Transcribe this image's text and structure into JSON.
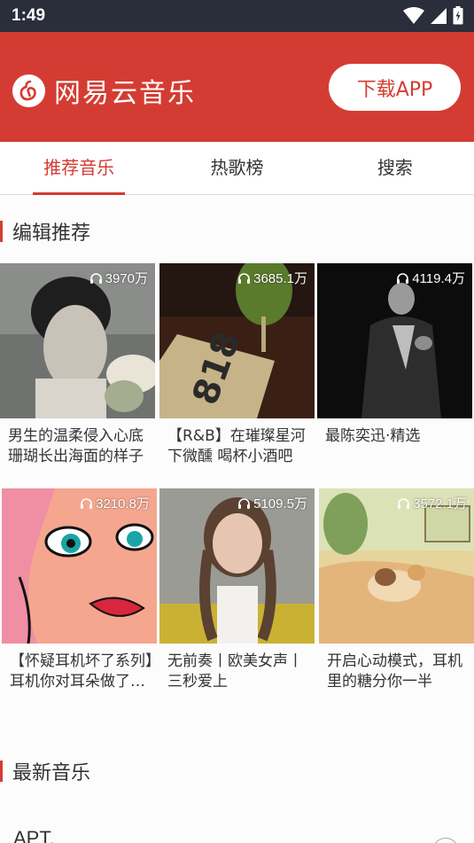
{
  "status_bar": {
    "time": "1:49",
    "icons": [
      "wifi-icon",
      "cell-signal-icon",
      "battery-icon"
    ]
  },
  "header": {
    "brand_name": "网易云音乐",
    "brand_icon": "netease-music-logo-icon",
    "download_label": "下载APP",
    "accent_color": "#d43c33"
  },
  "tabs": [
    {
      "label": "推荐音乐",
      "active": true
    },
    {
      "label": "热歌榜",
      "active": false
    },
    {
      "label": "搜索",
      "active": false
    }
  ],
  "sections": {
    "editor_picks_title": "编辑推荐",
    "new_music_title": "最新音乐"
  },
  "playlists": [
    {
      "count": "3970万",
      "title": "男生的温柔侵入心底 珊瑚长出海面的样子"
    },
    {
      "count": "3685.1万",
      "title": "【R&B】在璀璨星河下微醺 喝杯小酒吧"
    },
    {
      "count": "4119.4万",
      "title": "最陈奕迅·精选"
    },
    {
      "count": "3210.8万",
      "title": "【怀疑耳机坏了系列】耳机你对耳朵做了什么"
    },
    {
      "count": "5109.5万",
      "title": "无前奏丨欧美女声丨三秒爱上"
    },
    {
      "count": "3572.1万",
      "title": "开启心动模式，耳机里的糖分你一半"
    }
  ],
  "new_songs": [
    {
      "title": "APT."
    }
  ]
}
